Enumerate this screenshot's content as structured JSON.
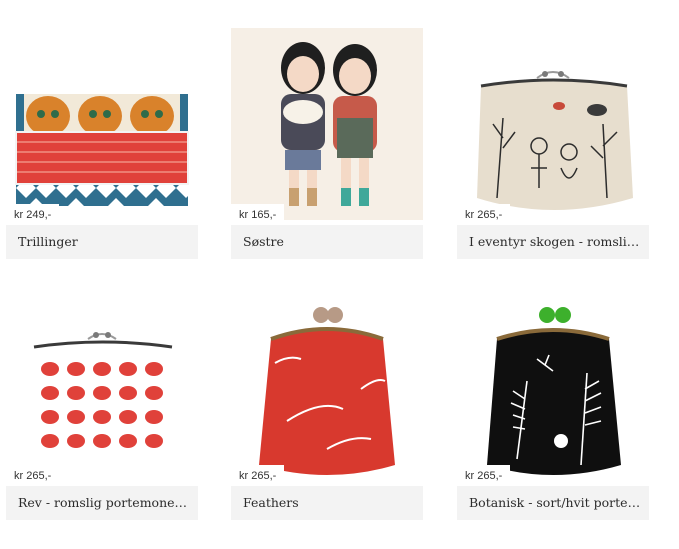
{
  "products": [
    {
      "price": "kr 249,-",
      "title": "Trillinger",
      "image": "kittens-in-box"
    },
    {
      "price": "kr 165,-",
      "title": "Søstre",
      "image": "sister-dolls"
    },
    {
      "price": "kr 265,-",
      "title": "I eventyr skogen - romslig portemone",
      "image": "fairytale-forest-purse"
    },
    {
      "price": "kr 265,-",
      "title": "Rev - romslig portemone / sminkepung",
      "image": "red-fox-purse"
    },
    {
      "price": "kr 265,-",
      "title": "Feathers",
      "image": "red-feathers-purse"
    },
    {
      "price": "kr 265,-",
      "title": "Botanisk - sort/hvit portemone",
      "image": "botanical-purse"
    }
  ],
  "colors": {
    "title_bar": "#f3f3f3",
    "text": "#2b2b2b",
    "accent_red": "#e0413a",
    "kiss_green": "#3db02c"
  }
}
